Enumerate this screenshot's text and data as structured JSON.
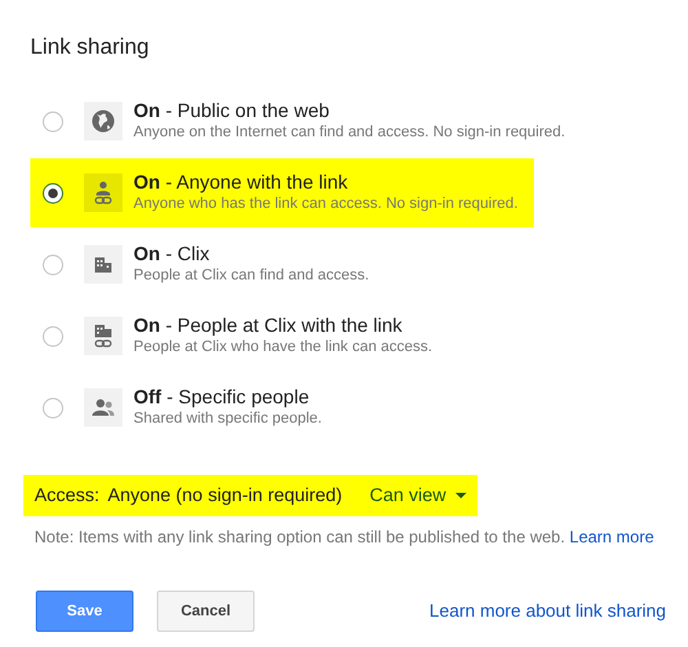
{
  "title": "Link sharing",
  "options": [
    {
      "kind": "globe",
      "label": "**On** - Public on the web",
      "description": "Anyone on the Internet can find and access. No sign-in required.",
      "selected": false,
      "highlighted": false
    },
    {
      "kind": "person-link",
      "label": "**On** - Anyone with the link",
      "description": "Anyone who has the link can access. No sign-in required.",
      "selected": true,
      "highlighted": true
    },
    {
      "kind": "building",
      "label": "**On** - Clix",
      "description": "People at Clix can find and access.",
      "selected": false,
      "highlighted": false
    },
    {
      "kind": "building-link",
      "label": "**On** - People at Clix with the link",
      "description": "People at Clix who have the link can access.",
      "selected": false,
      "highlighted": false
    },
    {
      "kind": "people",
      "label": "**Off** - Specific people",
      "description": "Shared with specific people.",
      "selected": false,
      "highlighted": false
    }
  ],
  "access": {
    "label": "Access:",
    "value": "Anyone (no sign-in required)",
    "permission": "Can view",
    "highlighted": true
  },
  "note": {
    "text": "Note: Items with any link sharing option can still be published to the web.",
    "link": "Learn more"
  },
  "buttons": [
    {
      "label": "Save",
      "kind": "primary"
    },
    {
      "label": "Cancel",
      "kind": "secondary"
    }
  ],
  "footer_link": "Learn more about link sharing"
}
